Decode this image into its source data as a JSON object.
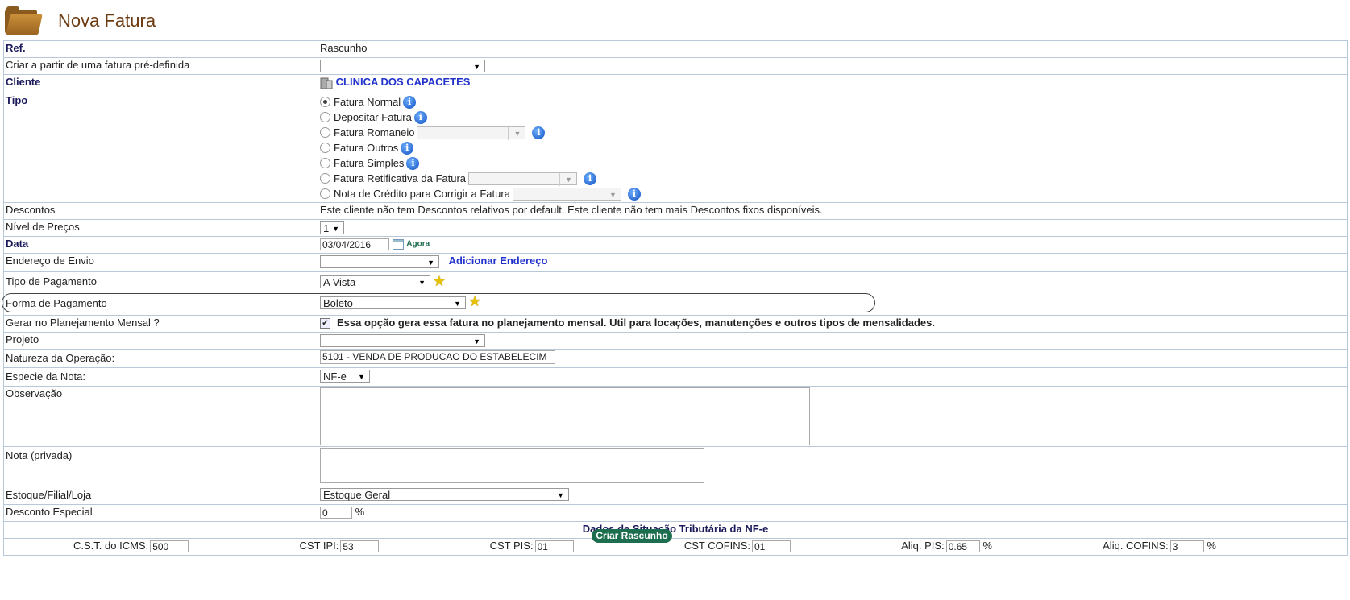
{
  "page": {
    "title": "Nova Fatura"
  },
  "rows": {
    "ref": {
      "label": "Ref.",
      "value": "Rascunho"
    },
    "template": {
      "label": "Criar a partir de uma fatura pré-definida",
      "value": ""
    },
    "cliente": {
      "label": "Cliente",
      "value": "CLINICA DOS CAPACETES"
    },
    "tipo": {
      "label": "Tipo",
      "options": [
        {
          "label": "Fatura Normal",
          "selected": true
        },
        {
          "label": "Depositar Fatura"
        },
        {
          "label": "Fatura Romaneio"
        },
        {
          "label": "Fatura Outros"
        },
        {
          "label": "Fatura Simples"
        },
        {
          "label": "Fatura Retificativa da Fatura"
        },
        {
          "label": "Nota de Crédito para Corrigir a Fatura"
        }
      ]
    },
    "descontos": {
      "label": "Descontos",
      "value": "Este cliente não tem Descontos relativos por default. Este cliente não tem mais Descontos fixos disponíveis."
    },
    "nivel": {
      "label": "Nível de Preços",
      "value": "1"
    },
    "data": {
      "label": "Data",
      "value": "03/04/2016",
      "now_label": "Agora"
    },
    "endereco": {
      "label": "Endereço de Envio",
      "value": "",
      "add_label": "Adicionar Endereço"
    },
    "tipo_pagamento": {
      "label": "Tipo de Pagamento",
      "value": "A Vista"
    },
    "forma_pagamento": {
      "label": "Forma de Pagamento",
      "value": "Boleto"
    },
    "planejamento": {
      "label": "Gerar no Planejamento Mensal ?",
      "checked": true,
      "note": "Essa opção gera essa fatura no planejamento mensal. Util para locações, manutenções e outros tipos de mensalidades."
    },
    "projeto": {
      "label": "Projeto",
      "value": ""
    },
    "natureza": {
      "label": "Natureza da Operação:",
      "value": "5101 - VENDA DE PRODUCAO DO ESTABELECIM"
    },
    "especie": {
      "label": "Especie da Nota:",
      "value": "NF-e"
    },
    "observacao": {
      "label": "Observação",
      "value": ""
    },
    "nota_privada": {
      "label": "Nota (privada)",
      "value": ""
    },
    "estoque": {
      "label": "Estoque/Filial/Loja",
      "value": "Estoque Geral"
    },
    "desconto_especial": {
      "label": "Desconto Especial",
      "value": "0",
      "unit": "%"
    }
  },
  "tributaria": {
    "title": "Dados de Situação Tributária da NF-e",
    "icms": {
      "label": "C.S.T. do ICMS:",
      "value": "500"
    },
    "ipi": {
      "label": "CST IPI:",
      "value": "53"
    },
    "pis": {
      "label": "CST PIS:",
      "value": "01"
    },
    "cofins": {
      "label": "CST COFINS:",
      "value": "01"
    },
    "aliq_pis": {
      "label": "Aliq. PIS:",
      "value": "0.65",
      "unit": "%"
    },
    "aliq_cofins": {
      "label": "Aliq. COFINS:",
      "value": "3",
      "unit": "%"
    }
  },
  "submit": {
    "label": "Criar Rascunho"
  }
}
